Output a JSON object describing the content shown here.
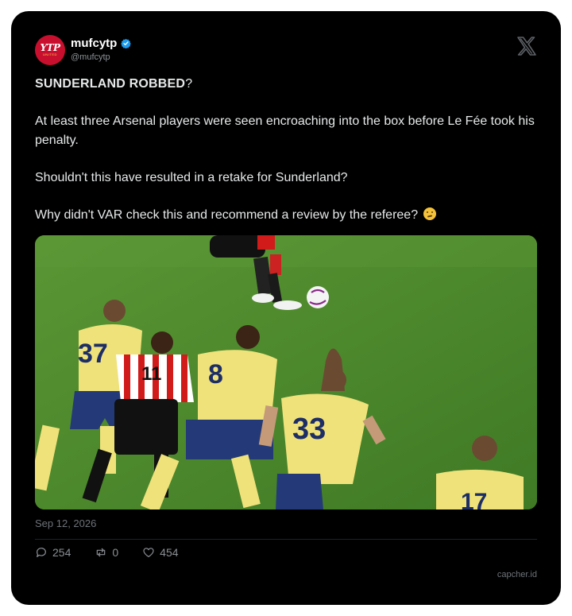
{
  "author": {
    "display_name": "mufcytp",
    "handle": "@mufcytp",
    "avatar_logo": "YTP",
    "avatar_sub": "UNITED",
    "verified": true,
    "verified_color": "#1d9bf0",
    "avatar_color": "#c8102e"
  },
  "platform_icon": "x-logo-icon",
  "tweet": {
    "headline": "SUNDERLAND ROBBED",
    "headline_suffix": "?",
    "paragraph_1": "At least three Arsenal players were seen encroaching into the box before Le Fée took his penalty.",
    "paragraph_2": "Shouldn't this have resulted in a retake for Sunderland?",
    "paragraph_3": "Why didn't VAR check this and recommend a review by the referee?",
    "paragraph_3_emoji": "thinking-face-emoji"
  },
  "media": {
    "description_icon": "football-photo",
    "shirt_numbers": [
      "37",
      "8",
      "33",
      "17",
      "11"
    ]
  },
  "date": "Sep 12, 2026",
  "stats": {
    "replies": "254",
    "reposts": "0",
    "likes": "454"
  },
  "watermark": "capcher.id",
  "colors": {
    "card_background": "#000000",
    "text": "#e7e9ea",
    "muted": "#8b8f94",
    "pitch": "#4f8a2d",
    "away_kit": "#f0e27a",
    "away_shorts": "#243a78"
  }
}
